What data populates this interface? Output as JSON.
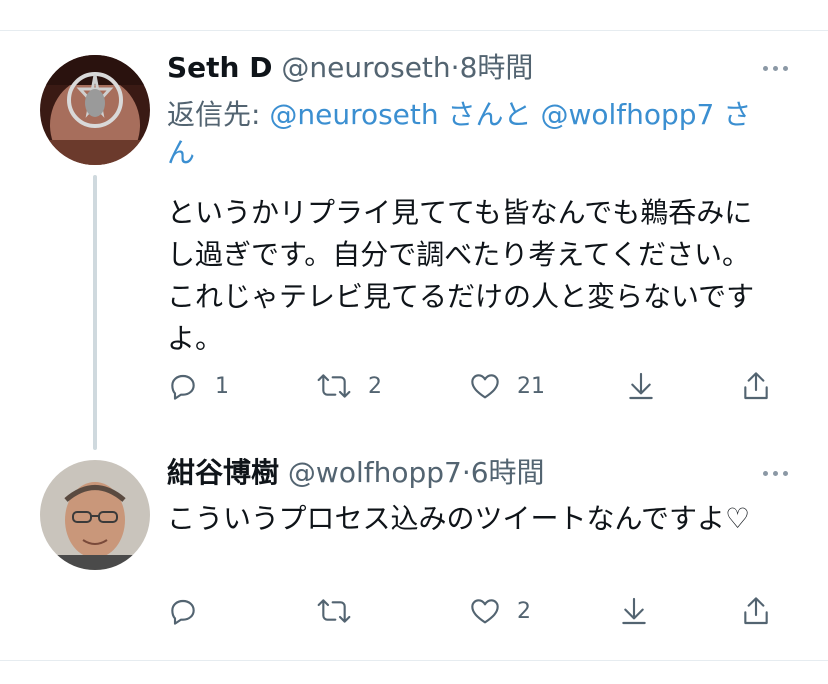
{
  "tweets": [
    {
      "display_name": "Seth D",
      "handle": "@neuroseth",
      "dot": "·",
      "time": "8時間",
      "reply_prefix": "返信先: ",
      "reply_user1": "@neuroseth",
      "reply_san1": " さんと ",
      "reply_user2": "@wolfhopp7",
      "reply_san2": " さん",
      "text": "というかリプライ見てても皆なんでも鵜呑みにし過ぎです。自分で調べたり考えてください。これじゃテレビ見てるだけの人と変らないですよ。",
      "reply_count": "1",
      "retweet_count": "2",
      "like_count": "21"
    },
    {
      "display_name": "紺谷博樹",
      "handle": "@wolfhopp7",
      "dot": "·",
      "time": "6時間",
      "text": "こういうプロセス込みのツイートなんですよ♡",
      "reply_count": "",
      "retweet_count": "",
      "like_count": "2"
    }
  ],
  "icons": {
    "reply": "reply-icon",
    "retweet": "retweet-icon",
    "like": "heart-icon",
    "download": "download-icon",
    "share": "share-icon",
    "more": "more-icon"
  },
  "colors": {
    "link": "#3b8fd1",
    "muted": "#536471",
    "thread_line": "#cfd9de"
  }
}
